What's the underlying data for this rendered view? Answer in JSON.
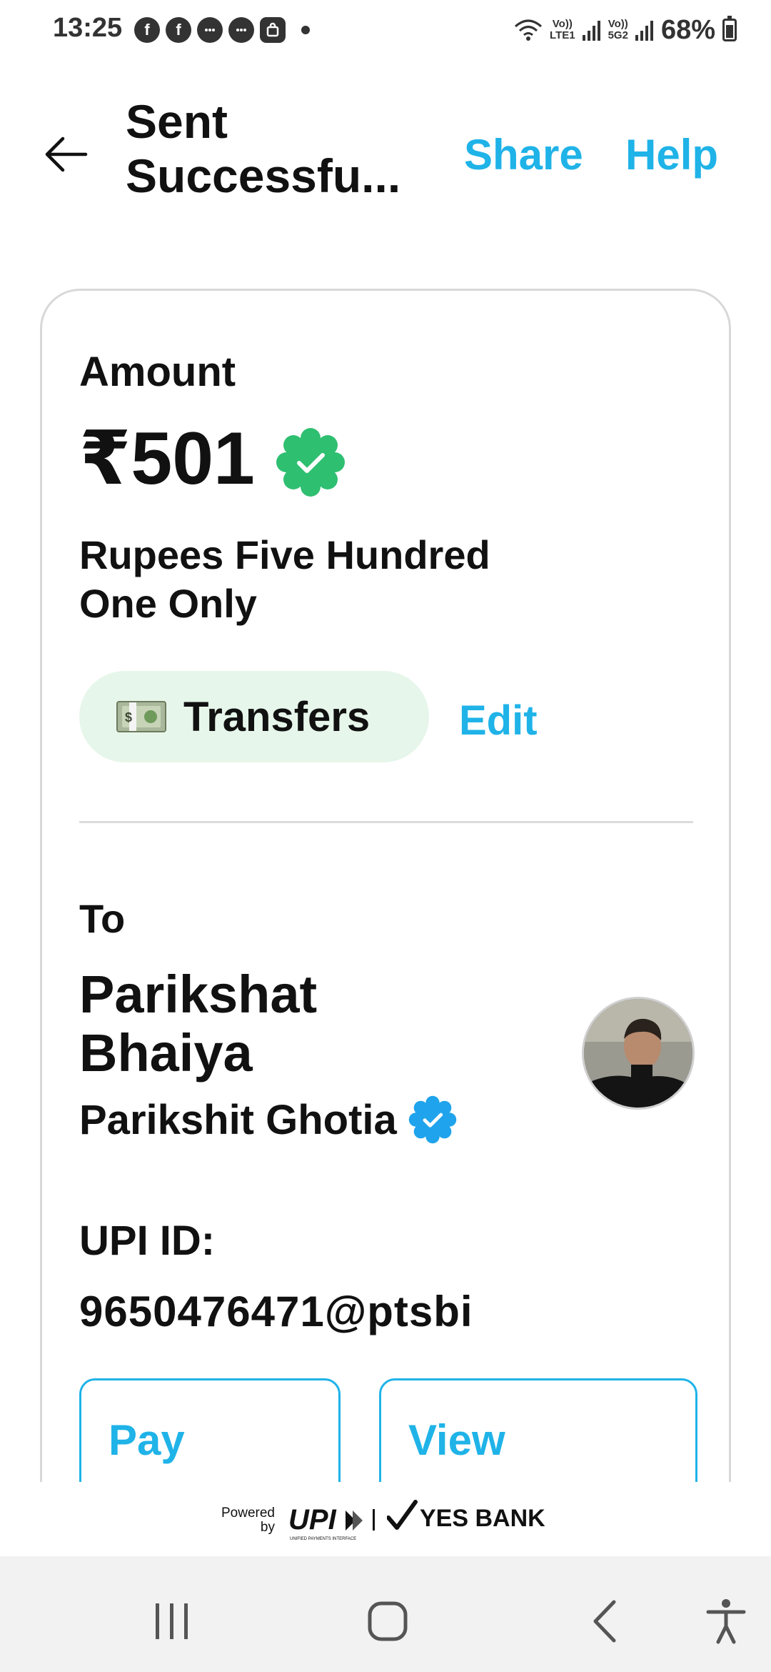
{
  "status_bar": {
    "time": "13:25",
    "network_1_top": "Vo))",
    "network_1_bottom": "LTE1",
    "network_2_top": "Vo))",
    "network_2_bottom": "5G2",
    "battery": "68%",
    "battery_level": 0.68,
    "notification_icons": [
      "facebook-icon",
      "facebook-icon",
      "messenger-icon",
      "chat-icon",
      "shopping-bag-icon"
    ]
  },
  "header": {
    "title_line1": "Sent",
    "title_line2": "Successfu...",
    "share_label": "Share",
    "help_label": "Help"
  },
  "amount": {
    "label": "Amount",
    "value": "₹501",
    "in_words_line1": "Rupees Five Hundred",
    "in_words_line2": "One Only"
  },
  "category": {
    "label": "Transfers",
    "edit_label": "Edit"
  },
  "recipient": {
    "to_label": "To",
    "name_line1": "Parikshat",
    "name_line2": "Bhaiya",
    "legal_name": "Parikshit Ghotia",
    "upi_label": "UPI ID:",
    "upi_id": "9650476471@ptsbi"
  },
  "actions": {
    "pay_again": "Pay",
    "view_history": "View"
  },
  "footer": {
    "powered_line1": "Powered",
    "powered_line2": "by",
    "upi_text": "UPI",
    "bank_name": "YES BANK"
  },
  "colors": {
    "accent": "#1fb3e8",
    "success_green": "#2fbf71",
    "chip_bg": "#e6f6ea"
  }
}
